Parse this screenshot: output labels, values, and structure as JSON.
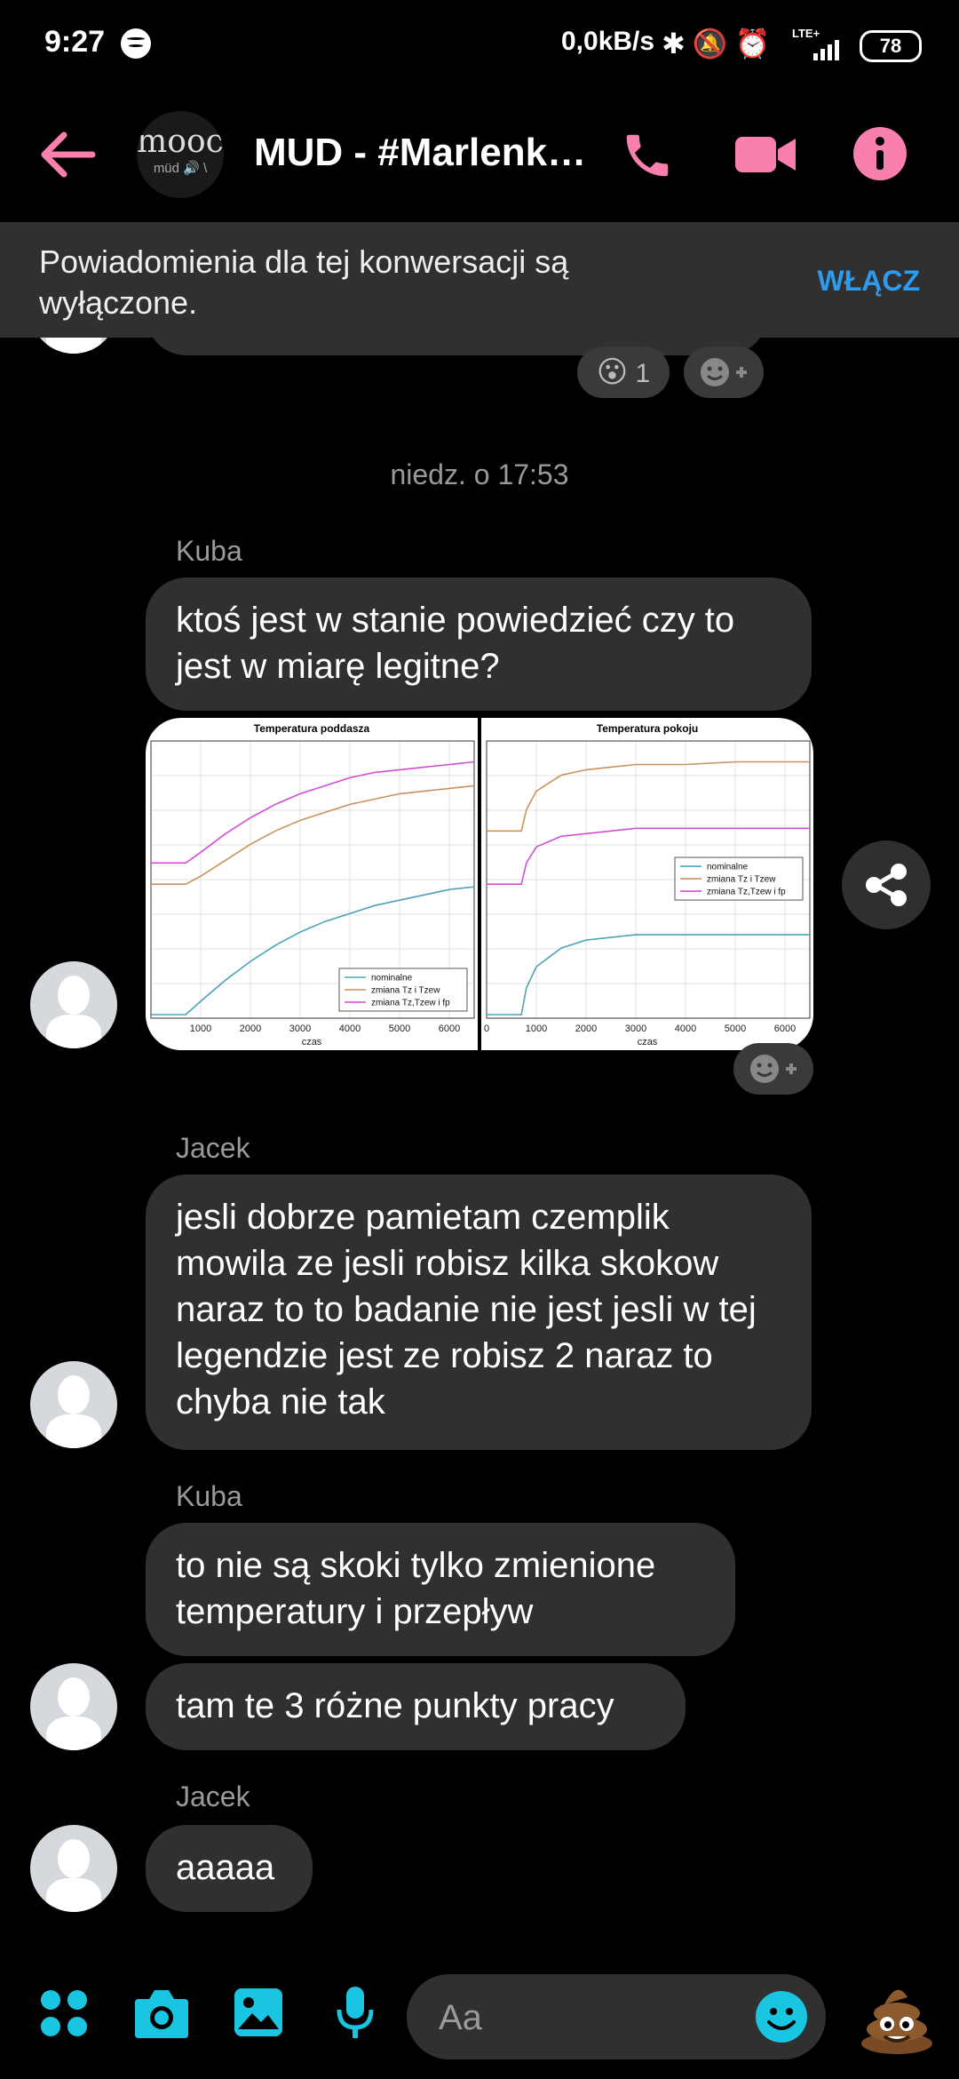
{
  "status_bar": {
    "time": "9:27",
    "network_speed": "0,0kB/s",
    "network_type": "LTE+",
    "battery": "78"
  },
  "header": {
    "title": "MUD - #Marlenka...",
    "group_avatar_text": "mooc",
    "group_avatar_subtext": "müd 🔊 \\",
    "accent_color": "#f97fae"
  },
  "banner": {
    "message": "Powiadomienia dla tej konwersacji są wyłączone.",
    "action": "WŁĄCZ"
  },
  "reactions": {
    "top_count": "1",
    "top_emoji": "😮"
  },
  "timestamp": "niedz. o 17:53",
  "messages": [
    {
      "sender": "Kuba",
      "text": "ktoś jest w stanie powiedzieć czy to jest w miarę legitne?"
    },
    {
      "sender": "Jacek",
      "text": "jesli dobrze pamietam czemplik mowila ze jesli robisz kilka skokow naraz to to badanie nie jest jesli w tej legendzie jest ze robisz 2 naraz to chyba nie tak"
    },
    {
      "sender": "Kuba",
      "text": "to nie są skoki tylko zmienione temperatury i przepływ"
    },
    {
      "sender": "",
      "text": "tam te 3 różne punkty pracy"
    },
    {
      "sender": "Jacek",
      "text": "aaaaa"
    }
  ],
  "composer": {
    "placeholder": "Aa",
    "accent_color": "#19c5e0"
  },
  "chart_data": [
    {
      "type": "line",
      "title": "Temperatura poddasza",
      "xlabel": "czas",
      "x_ticks": [
        1000,
        2000,
        3000,
        4000,
        5000,
        6000
      ],
      "xlim": [
        0,
        6500
      ],
      "legend": [
        "nominalne",
        "zmiana Tz i Tzew",
        "zmiana Tz,Tzew i fp"
      ],
      "legend_position": "bottom-right",
      "series": [
        {
          "name": "nominalne",
          "color": "#4aa3b8",
          "x": [
            0,
            700,
            1000,
            1500,
            2000,
            2500,
            3000,
            3500,
            4000,
            4500,
            5000,
            5500,
            6000,
            6500
          ],
          "y": [
            0.0,
            0.0,
            0.05,
            0.13,
            0.2,
            0.26,
            0.31,
            0.35,
            0.38,
            0.41,
            0.43,
            0.45,
            0.47,
            0.48
          ]
        },
        {
          "name": "zmiana Tz i Tzew",
          "color": "#c9925a",
          "x": [
            0,
            700,
            1000,
            1500,
            2000,
            2500,
            3000,
            3500,
            4000,
            4500,
            5000,
            5500,
            6000,
            6500
          ],
          "y": [
            0.49,
            0.49,
            0.52,
            0.58,
            0.64,
            0.69,
            0.73,
            0.76,
            0.79,
            0.81,
            0.83,
            0.84,
            0.85,
            0.86
          ]
        },
        {
          "name": "zmiana Tz,Tzew i fp",
          "color": "#d24fd6",
          "x": [
            0,
            700,
            1000,
            1500,
            2000,
            2500,
            3000,
            3500,
            4000,
            4500,
            5000,
            5500,
            6000,
            6500
          ],
          "y": [
            0.57,
            0.57,
            0.61,
            0.68,
            0.74,
            0.79,
            0.83,
            0.86,
            0.89,
            0.91,
            0.92,
            0.93,
            0.94,
            0.95
          ]
        }
      ]
    },
    {
      "type": "line",
      "title": "Temperatura pokoju",
      "xlabel": "czas",
      "x_ticks": [
        0,
        1000,
        2000,
        3000,
        4000,
        5000,
        6000
      ],
      "xlim": [
        0,
        6500
      ],
      "legend": [
        "nominalne",
        "zmiana Tz i Tzew",
        "zmiana Tz,Tzew i fp"
      ],
      "legend_position": "middle-right",
      "series": [
        {
          "name": "nominalne",
          "color": "#4aa3b8",
          "x": [
            0,
            700,
            800,
            1000,
            1500,
            2000,
            2500,
            3000,
            4000,
            5000,
            6000,
            6500
          ],
          "y": [
            0.0,
            0.0,
            0.1,
            0.18,
            0.25,
            0.28,
            0.29,
            0.3,
            0.3,
            0.3,
            0.3,
            0.3
          ]
        },
        {
          "name": "zmiana Tz i Tzew",
          "color": "#c9925a",
          "x": [
            0,
            700,
            800,
            1000,
            1500,
            2000,
            2500,
            3000,
            4000,
            5000,
            6000,
            6500
          ],
          "y": [
            0.69,
            0.69,
            0.77,
            0.84,
            0.9,
            0.92,
            0.93,
            0.94,
            0.94,
            0.95,
            0.95,
            0.95
          ]
        },
        {
          "name": "zmiana Tz,Tzew i fp",
          "color": "#d24fd6",
          "x": [
            0,
            700,
            800,
            1000,
            1500,
            2000,
            2500,
            3000,
            4000,
            5000,
            6000,
            6500
          ],
          "y": [
            0.49,
            0.49,
            0.57,
            0.63,
            0.67,
            0.68,
            0.69,
            0.7,
            0.7,
            0.7,
            0.7,
            0.7
          ]
        }
      ]
    }
  ]
}
